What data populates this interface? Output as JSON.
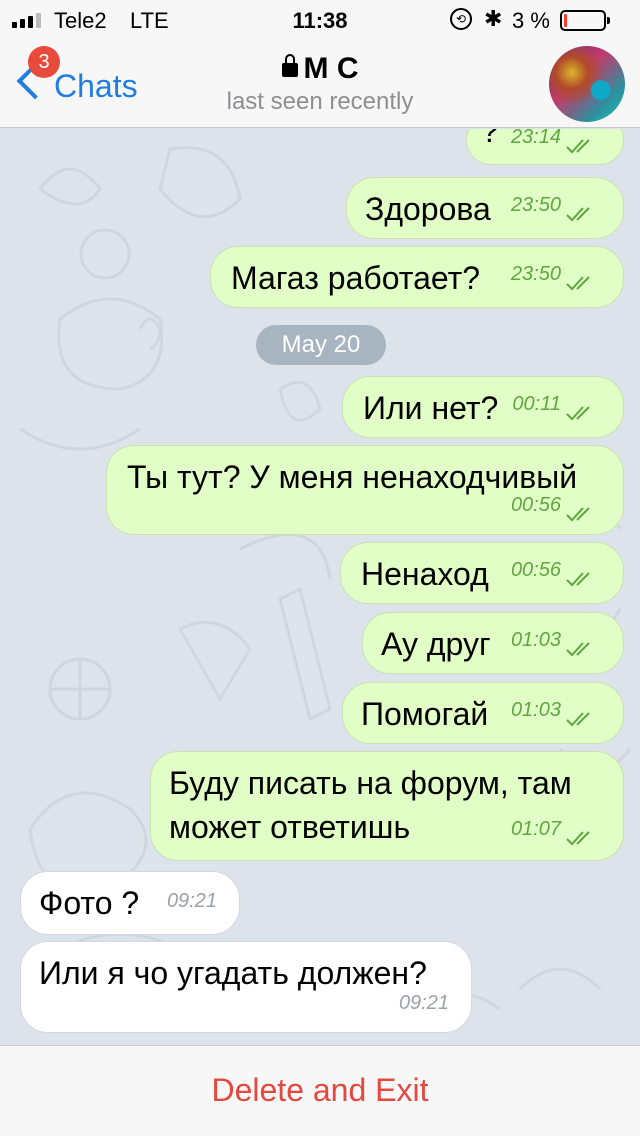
{
  "status_bar": {
    "carrier": "Tele2",
    "network": "LTE",
    "time": "11:38",
    "battery_percent": "3 %",
    "bluetooth": "✱",
    "battery_level": 0.03
  },
  "nav": {
    "back_label": "Chats",
    "unread_badge": "3",
    "title": "M C",
    "subtitle": "last seen recently"
  },
  "messages": [
    {
      "dir": "out",
      "text": "?",
      "time": "23:14"
    },
    {
      "dir": "out",
      "text": "Здорова",
      "time": "23:50"
    },
    {
      "dir": "out",
      "text": "Магаз работает?",
      "time": "23:50"
    },
    {
      "dir": "out",
      "text": "Или нет?",
      "time": "00:11"
    },
    {
      "dir": "out",
      "text": "Ты тут? У меня ненаходчивый",
      "time": "00:56"
    },
    {
      "dir": "out",
      "text": "Ненаход",
      "time": "00:56"
    },
    {
      "dir": "out",
      "text": "Ау друг",
      "time": "01:03"
    },
    {
      "dir": "out",
      "text": "Помогай",
      "time": "01:03"
    },
    {
      "dir": "out",
      "text": "Буду писать на форум, там",
      "text2": "может ответишь",
      "time": "01:07"
    },
    {
      "dir": "in",
      "text": "Фото ?",
      "time": "09:21"
    },
    {
      "dir": "in",
      "text": "Или я чо угадать должен?",
      "time": "09:21"
    }
  ],
  "date_separator": "May 20",
  "bottom": {
    "delete_label": "Delete and Exit"
  },
  "colors": {
    "accent": "#1f7ee0",
    "outgoing_bubble": "#e1fec6",
    "outgoing_meta": "#5ea83f",
    "destructive": "#e5483e",
    "badge": "#e84a3c"
  }
}
